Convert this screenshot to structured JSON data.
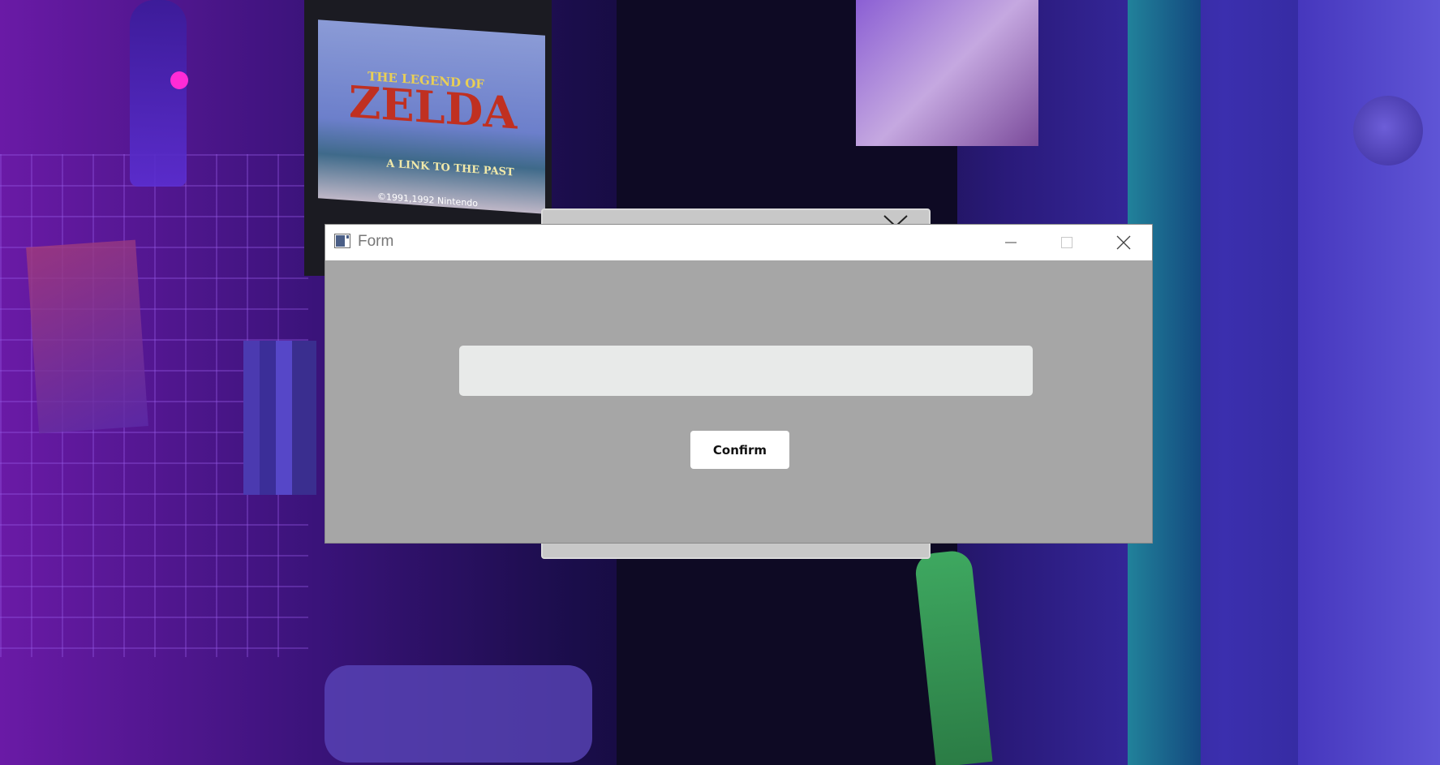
{
  "desktop": {
    "wallpaper_texts": {
      "game_title_top": "THE LEGEND OF",
      "game_title_main": "ZELDA",
      "game_subtitle": "A LINK TO THE PAST",
      "copyright": "©1991,1992 Nintendo"
    }
  },
  "window": {
    "title": "Form",
    "icon": "app-window-icon",
    "controls": {
      "minimize_icon": "minimize-icon",
      "maximize_icon": "maximize-icon",
      "close_icon": "close-icon"
    },
    "input": {
      "value": "",
      "placeholder": ""
    },
    "confirm_label": "Confirm",
    "colors": {
      "client_background": "#a6a6a6",
      "titlebar_background": "#ffffff",
      "input_background": "#e8eae9",
      "button_background": "#ffffff"
    }
  }
}
